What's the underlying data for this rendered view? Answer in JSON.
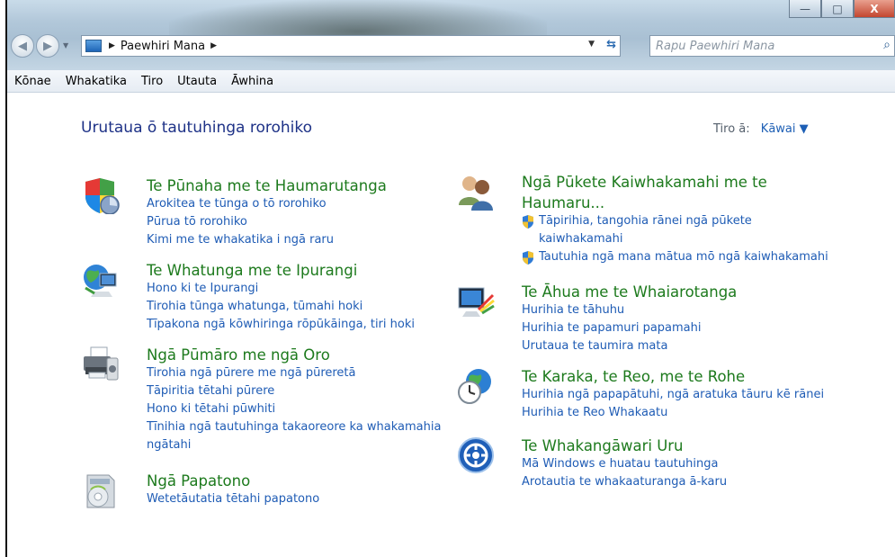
{
  "window": {
    "buttons": {
      "minimize": "—",
      "maximize": "□",
      "close": "X"
    }
  },
  "address_bar": {
    "breadcrumbs": [
      "Paewhiri Mana"
    ],
    "search_placeholder": "Rapu Paewhiri Mana"
  },
  "menu": [
    "Kōnae",
    "Whakatika",
    "Tiro",
    "Utauta",
    "Āwhina"
  ],
  "page": {
    "title": "Urutaua ō tautuhinga rorohiko",
    "view_by_label": "Tiro ā:",
    "view_by_value": "Kāwai"
  },
  "categories": [
    {
      "icon": "shield-computer-icon",
      "heading": "Te Pūnaha me te Haumarutanga",
      "links": [
        "Arokitea te tūnga o tō rorohiko",
        "Pūrua tō rorohiko",
        "Kimi me te whakatika i ngā raru"
      ]
    },
    {
      "icon": "network-globe-icon",
      "heading": "Te Whatunga me te Ipurangi",
      "links": [
        "Hono ki te Ipurangi",
        "Tirohia tūnga whatunga, tūmahi hoki",
        "Tīpakona ngā kōwhiringa rōpūkāinga, tiri hoki"
      ]
    },
    {
      "icon": "printer-icon",
      "heading": "Ngā Pūmāro me ngā Oro",
      "links": [
        "Tirohia ngā pūrere me ngā pūreretā",
        "Tāpiritia tētahi pūrere",
        "Hono ki tētahi pūwhiti",
        "Tīnihia ngā tautuhinga takaoreore ka whakamahia",
        "ngātahi"
      ]
    },
    {
      "icon": "programs-disc-icon",
      "heading": "Ngā Papatono",
      "links": [
        "Wetetāutatia tētahi papatono"
      ]
    },
    {
      "icon": "user-accounts-icon",
      "heading": "Ngā Pūkete Kaiwhakamahi me te",
      "heading2": "Haumaru...",
      "links": [
        "Tāpirihia, tangohia rānei ngā pūkete",
        "kaiwhakamahi",
        "Tautuhia ngā mana mātua mō ngā kaiwhakamahi"
      ]
    },
    {
      "icon": "appearance-monitor-icon",
      "heading": "Te Āhua me te Whaiarotanga",
      "links": [
        "Hurihia te tāhuhu",
        "Hurihia te papamuri papamahi",
        "Urutaua te taumira mata"
      ]
    },
    {
      "icon": "clock-globe-icon",
      "heading": "Te Karaka, te Reo, me te Rohe",
      "links": [
        "Hurihia ngā papapātuhi, ngā aratuka tāuru kē rānei",
        "Hurihia te Reo Whakaatu"
      ]
    },
    {
      "icon": "ease-of-access-icon",
      "heading": "Te Whakangāwari Uru",
      "links": [
        "Mā Windows e huatau tautuhinga",
        "Arotautia te whakaaturanga ā-karu"
      ]
    }
  ],
  "colors": {
    "heading": "#1d7a1d",
    "link": "#1f5cb5",
    "title": "#1e3287"
  }
}
